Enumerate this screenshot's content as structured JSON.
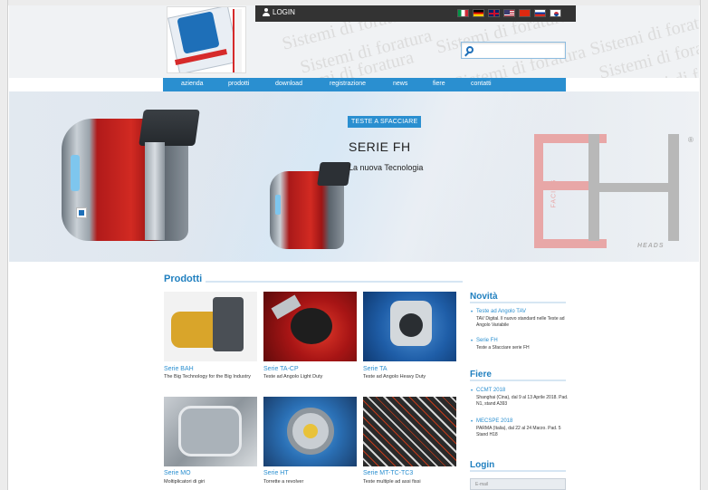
{
  "header": {
    "login_label": "LOGIN",
    "background_text": "Sistemi di foratura",
    "flags": [
      {
        "name": "italian-flag-icon",
        "cls": "flag-it"
      },
      {
        "name": "german-flag-icon",
        "cls": "flag-de"
      },
      {
        "name": "uk-flag-icon",
        "cls": "flag-uk"
      },
      {
        "name": "us-flag-icon",
        "cls": "flag-us"
      },
      {
        "name": "chinese-flag-icon",
        "cls": "flag-cn"
      },
      {
        "name": "russian-flag-icon",
        "cls": "flag-ru"
      },
      {
        "name": "korean-flag-icon",
        "cls": "flag-kr"
      }
    ],
    "search_placeholder": ""
  },
  "nav": {
    "items": [
      "azienda",
      "prodotti",
      "download",
      "registrazione",
      "news",
      "fiere",
      "contatti"
    ]
  },
  "hero": {
    "badge": "TESTE A SFACCIARE",
    "title": "SERIE FH",
    "subtitle": "La nuova Tecnologia",
    "logo_side_text": "FACING",
    "logo_bottom_text": "HEADS",
    "logo_reg": "®"
  },
  "products": {
    "title": "Prodotti",
    "items": [
      {
        "title": "Serie BAH",
        "desc": "The Big Technology for the Big Industry"
      },
      {
        "title": "Serie TA-CP",
        "desc": "Teste ad Angolo Light Duty"
      },
      {
        "title": "Serie TA",
        "desc": "Teste ad Angolo Heavy Duty"
      },
      {
        "title": "Serie MO",
        "desc": "Moltiplicatori di giri"
      },
      {
        "title": "Serie HT",
        "desc": "Torrette a revolver"
      },
      {
        "title": "Serie MT-TC-TC3",
        "desc": "Teste multiple ad assi fissi"
      }
    ]
  },
  "sidebar": {
    "novita_title": "Novità",
    "novita": [
      {
        "title": "Teste ad Angolo TAV",
        "text": "TAV Digital. Il nuovo standard nelle Teste ad Angolo Variabile"
      },
      {
        "title": "Serie FH",
        "text": "Teste a Sfacciare serie FH"
      }
    ],
    "fiere_title": "Fiere",
    "fiere": [
      {
        "title": "CCMT 2018",
        "text": "Shanghai (Cina), dal 9 al 13 Aprile 2018. Pad. N1, stand A393"
      },
      {
        "title": "MECSPE 2018",
        "text": "PARMA (Italia), dal 22 al 24 Marzo. Pad. 5 Stand H18"
      }
    ],
    "login_title": "Login",
    "login_field_label": "E-mail"
  },
  "colors": {
    "accent": "#2a8fd0",
    "heading": "#1f7fbf",
    "topbar": "#333333",
    "brand_red": "#d22a22"
  }
}
